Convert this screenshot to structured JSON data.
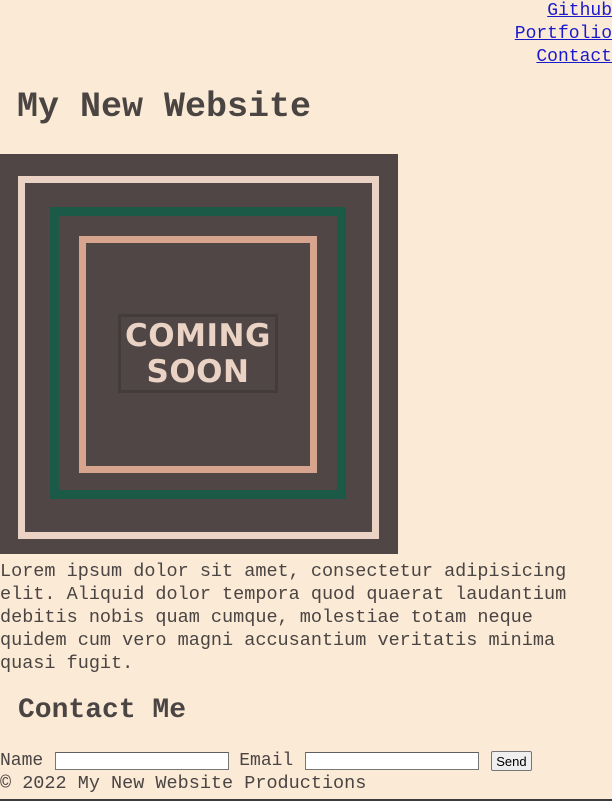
{
  "nav": {
    "links": [
      {
        "label": "Github"
      },
      {
        "label": "Portfolio"
      },
      {
        "label": "Contact"
      }
    ]
  },
  "header": {
    "title": "My New Website"
  },
  "hero": {
    "line1": "COMING",
    "line2": "SOON"
  },
  "main": {
    "paragraph_lines": [
      "Lorem ipsum dolor sit amet, consectetur adipisicing",
      "elit. Aliquid dolor tempora quod quaerat laudantium",
      "debitis nobis quam cumque, molestiae totam neque",
      "quidem cum vero magni accusantium veritatis minima",
      "quasi fugit."
    ]
  },
  "contact": {
    "heading": "Contact Me",
    "name_label": "Name",
    "name_value": "",
    "email_label": "Email",
    "email_value": "",
    "send_label": "Send"
  },
  "footer": {
    "text": "© 2022 My New Website Productions"
  },
  "colors": {
    "background": "#fbead6",
    "text": "#4a4543",
    "link": "#1a1acc",
    "hero_background": "#4f4645",
    "frame_outer": "#ead2c5",
    "frame_middle": "#1c5a48",
    "frame_inner": "#d7a48d"
  }
}
